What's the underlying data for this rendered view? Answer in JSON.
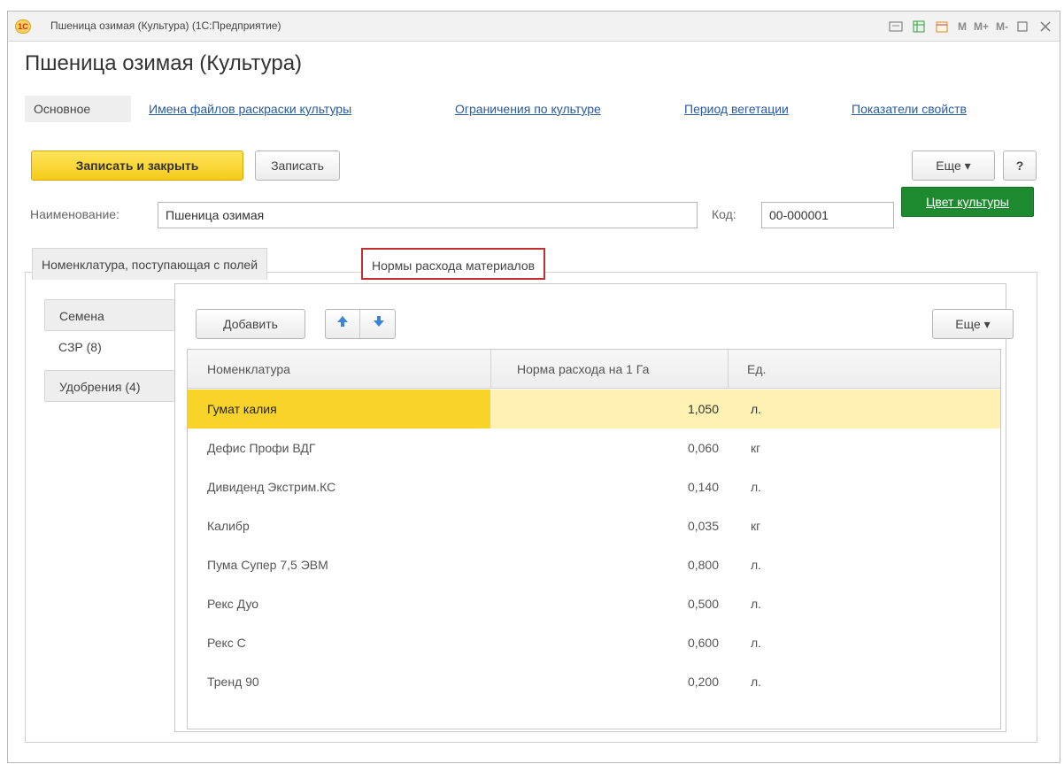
{
  "window": {
    "title": "Пшеница озимая (Культура)  (1С:Предприятие)",
    "logo_text": "1С",
    "controls": [
      "M",
      "M+",
      "M-"
    ]
  },
  "page_title": "Пшеница озимая (Культура)",
  "nav": {
    "main": "Основное",
    "links": [
      "Имена файлов раскраски культуры",
      "Ограничения по культуре",
      "Период вегетации",
      "Показатели свойств"
    ]
  },
  "toolbar": {
    "save_close": "Записать и закрыть",
    "save": "Записать",
    "more": "Еще ▾",
    "help": "?"
  },
  "form": {
    "name_label": "Наименование:",
    "name_value": "Пшеница озимая",
    "code_label": "Код:",
    "code_value": "00-000001",
    "color_button": "Цвет культуры"
  },
  "tabs": [
    "Номенклатура, поступающая с полей",
    "Нормы расхода материалов"
  ],
  "vertical_tabs": [
    "Семена",
    "СЗР (8)",
    "Удобрения (4)"
  ],
  "table_toolbar": {
    "add": "Добавить",
    "more": "Еще ▾"
  },
  "table": {
    "columns": [
      "Номенклатура",
      "Норма расхода на 1 Га",
      "Ед."
    ],
    "rows": [
      {
        "name": "Гумат калия",
        "norm": "1,050",
        "unit": "л."
      },
      {
        "name": "Дефис Профи ВДГ",
        "norm": "0,060",
        "unit": "кг"
      },
      {
        "name": "Дивиденд Экстрим.КС",
        "norm": "0,140",
        "unit": "л."
      },
      {
        "name": "Калибр",
        "norm": "0,035",
        "unit": "кг"
      },
      {
        "name": "Пума Супер 7,5 ЭВМ",
        "norm": "0,800",
        "unit": "л."
      },
      {
        "name": "Рекс Дуо",
        "norm": "0,500",
        "unit": "л."
      },
      {
        "name": "Рекс С",
        "norm": "0,600",
        "unit": "л."
      },
      {
        "name": "Тренд 90",
        "norm": "0,200",
        "unit": "л."
      }
    ]
  }
}
